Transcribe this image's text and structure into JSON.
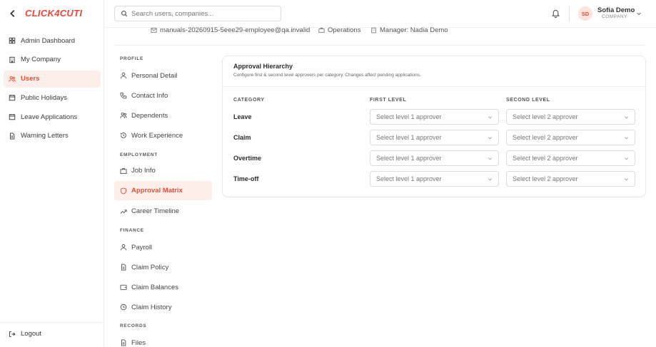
{
  "app": {
    "logo": "CLICK4CUTI"
  },
  "sidebar": {
    "items": [
      {
        "label": "Admin Dashboard",
        "icon": "grid-icon",
        "active": false
      },
      {
        "label": "My Company",
        "icon": "building-icon",
        "active": false
      },
      {
        "label": "Users",
        "icon": "users-icon",
        "active": true
      },
      {
        "label": "Public Holidays",
        "icon": "calendar-icon",
        "active": false
      },
      {
        "label": "Leave Applications",
        "icon": "calendar-icon",
        "active": false
      },
      {
        "label": "Warning Letters",
        "icon": "document-icon",
        "active": false
      }
    ],
    "logout": "Logout"
  },
  "header": {
    "search_placeholder": "Search users, companies...",
    "user": {
      "initials": "SD",
      "name": "Sofia Demo",
      "role": "COMPANY"
    }
  },
  "profile_meta": {
    "email": "manuals-20260915-5eee29-employee@qa.invalid",
    "department": "Operations",
    "manager": "Manager: Nadia Demo"
  },
  "subnav": {
    "sections": [
      {
        "label": "PROFILE",
        "items": [
          {
            "label": "Personal Detail",
            "icon": "user-icon"
          },
          {
            "label": "Contact Info",
            "icon": "phone-icon"
          },
          {
            "label": "Dependents",
            "icon": "users-icon"
          },
          {
            "label": "Work Experience",
            "icon": "history-icon"
          }
        ]
      },
      {
        "label": "EMPLOYMENT",
        "items": [
          {
            "label": "Job Info",
            "icon": "briefcase-icon"
          },
          {
            "label": "Approval Matrix",
            "icon": "shield-icon",
            "active": true
          },
          {
            "label": "Career Timeline",
            "icon": "trend-icon"
          }
        ]
      },
      {
        "label": "FINANCE",
        "items": [
          {
            "label": "Payroll",
            "icon": "user-icon"
          },
          {
            "label": "Claim Policy",
            "icon": "document-icon"
          },
          {
            "label": "Claim Balances",
            "icon": "wallet-icon"
          },
          {
            "label": "Claim History",
            "icon": "clock-icon"
          }
        ]
      },
      {
        "label": "RECORDS",
        "items": [
          {
            "label": "Files",
            "icon": "document-icon"
          }
        ]
      }
    ]
  },
  "approval": {
    "title": "Approval Hierarchy",
    "subtitle": "Configure first & second level approvers per category. Changes affect pending applications.",
    "headers": {
      "category": "CATEGORY",
      "first": "FIRST LEVEL",
      "second": "SECOND LEVEL"
    },
    "rows": [
      {
        "category": "Leave",
        "first": "Select level 1 approver",
        "second": "Select level 2 approver"
      },
      {
        "category": "Claim",
        "first": "Select level 1 approver",
        "second": "Select level 2 approver"
      },
      {
        "category": "Overtime",
        "first": "Select level 1 approver",
        "second": "Select level 2 approver"
      },
      {
        "category": "Time-off",
        "first": "Select level 1 approver",
        "second": "Select level 2 approver"
      }
    ]
  },
  "colors": {
    "accent": "#e0533b",
    "active_bg": "#fdeee9"
  }
}
